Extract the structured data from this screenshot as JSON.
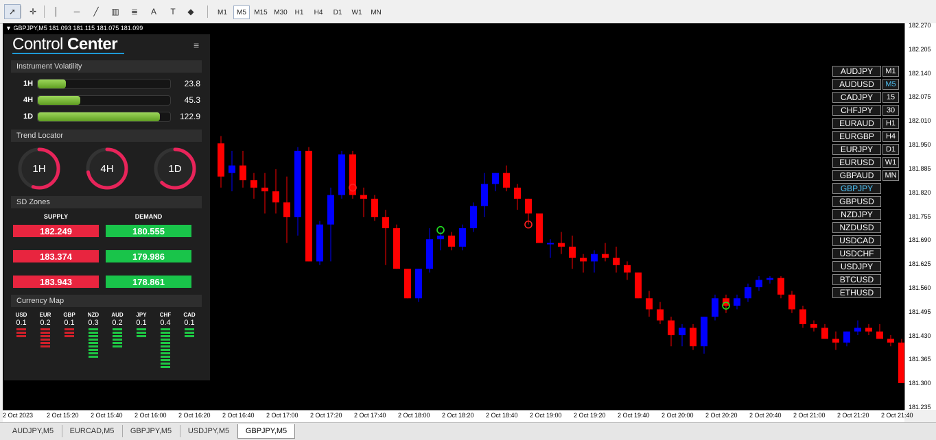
{
  "toolbar": {
    "tools": [
      {
        "name": "cursor-icon",
        "glyph": "➚"
      },
      {
        "name": "crosshair-icon",
        "glyph": "✛"
      },
      {
        "name": "vertical-line-icon",
        "glyph": "│"
      },
      {
        "name": "horizontal-line-icon",
        "glyph": "─"
      },
      {
        "name": "trend-line-icon",
        "glyph": "╱"
      },
      {
        "name": "channel-icon",
        "glyph": "▥"
      },
      {
        "name": "fibonacci-icon",
        "glyph": "≣"
      },
      {
        "name": "text-icon",
        "glyph": "A"
      },
      {
        "name": "text-label-icon",
        "glyph": "T"
      },
      {
        "name": "shapes-icon",
        "glyph": "◆"
      }
    ],
    "timeframes": [
      "M1",
      "M5",
      "M15",
      "M30",
      "H1",
      "H4",
      "D1",
      "W1",
      "MN"
    ],
    "active_timeframe": "M5"
  },
  "chart": {
    "header": "GBPJPY,M5  181.093 181.115 181.075 181.099",
    "ymin": 181.235,
    "ymax": 182.27,
    "y_labels": [
      "182.270",
      "182.205",
      "182.140",
      "182.075",
      "182.010",
      "181.950",
      "181.885",
      "181.820",
      "181.755",
      "181.690",
      "181.625",
      "181.560",
      "181.495",
      "181.430",
      "181.365",
      "181.300",
      "181.235"
    ],
    "x_labels": [
      "2 Oct 2023",
      "2 Oct 15:20",
      "2 Oct 15:40",
      "2 Oct 16:00",
      "2 Oct 16:20",
      "2 Oct 16:40",
      "2 Oct 17:00",
      "2 Oct 17:20",
      "2 Oct 17:40",
      "2 Oct 18:00",
      "2 Oct 18:20",
      "2 Oct 18:40",
      "2 Oct 19:00",
      "2 Oct 19:20",
      "2 Oct 19:40",
      "2 Oct 20:00",
      "2 Oct 20:20",
      "2 Oct 20:40",
      "2 Oct 21:00",
      "2 Oct 21:20",
      "2 Oct 21:40"
    ],
    "colors": {
      "bull": "#0000ff",
      "bear": "#ff0000",
      "signal_sell": "#ff2020",
      "signal_buy": "#20e020"
    }
  },
  "chart_data": {
    "type": "candlestick",
    "ohlc": [
      [
        181.95,
        181.97,
        181.83,
        181.86
      ],
      [
        181.87,
        181.93,
        181.82,
        181.89
      ],
      [
        181.89,
        181.93,
        181.83,
        181.85
      ],
      [
        181.85,
        181.87,
        181.8,
        181.83
      ],
      [
        181.83,
        181.87,
        181.76,
        181.82
      ],
      [
        181.82,
        181.88,
        181.76,
        181.79
      ],
      [
        181.79,
        181.86,
        181.68,
        181.75
      ],
      [
        181.75,
        181.94,
        181.7,
        181.93
      ],
      [
        181.93,
        181.94,
        181.63,
        181.63
      ],
      [
        181.63,
        181.74,
        181.62,
        181.73
      ],
      [
        181.73,
        181.83,
        181.63,
        181.81
      ],
      [
        181.81,
        181.93,
        181.8,
        181.92
      ],
      [
        181.92,
        181.93,
        181.8,
        181.81
      ],
      [
        181.81,
        181.83,
        181.75,
        181.8
      ],
      [
        181.8,
        181.81,
        181.74,
        181.75
      ],
      [
        181.75,
        181.77,
        181.62,
        181.72
      ],
      [
        181.72,
        181.73,
        181.61,
        181.61
      ],
      [
        181.61,
        181.61,
        181.53,
        181.53
      ],
      [
        181.53,
        181.61,
        181.52,
        181.61
      ],
      [
        181.61,
        181.72,
        181.6,
        181.69
      ],
      [
        181.69,
        181.71,
        181.66,
        181.7
      ],
      [
        181.7,
        181.71,
        181.66,
        181.67
      ],
      [
        181.67,
        181.73,
        181.66,
        181.72
      ],
      [
        181.72,
        181.79,
        181.71,
        181.78
      ],
      [
        181.78,
        181.87,
        181.75,
        181.84
      ],
      [
        181.84,
        181.87,
        181.82,
        181.87
      ],
      [
        181.87,
        181.89,
        181.82,
        181.83
      ],
      [
        181.83,
        181.84,
        181.77,
        181.8
      ],
      [
        181.8,
        181.8,
        181.73,
        181.76
      ],
      [
        181.76,
        181.76,
        181.68,
        181.68
      ],
      [
        181.68,
        181.69,
        181.64,
        181.68
      ],
      [
        181.68,
        181.71,
        181.65,
        181.67
      ],
      [
        181.67,
        181.7,
        181.61,
        181.64
      ],
      [
        181.64,
        181.65,
        181.6,
        181.63
      ],
      [
        181.63,
        181.66,
        181.6,
        181.65
      ],
      [
        181.65,
        181.68,
        181.63,
        181.64
      ],
      [
        181.64,
        181.67,
        181.6,
        181.62
      ],
      [
        181.62,
        181.63,
        181.58,
        181.6
      ],
      [
        181.6,
        181.6,
        181.53,
        181.53
      ],
      [
        181.53,
        181.55,
        181.48,
        181.5
      ],
      [
        181.5,
        181.52,
        181.46,
        181.47
      ],
      [
        181.47,
        181.48,
        181.4,
        181.43
      ],
      [
        181.43,
        181.46,
        181.4,
        181.45
      ],
      [
        181.45,
        181.46,
        181.39,
        181.4
      ],
      [
        181.4,
        181.48,
        181.38,
        181.48
      ],
      [
        181.48,
        181.54,
        181.47,
        181.53
      ],
      [
        181.53,
        181.54,
        181.49,
        181.51
      ],
      [
        181.51,
        181.54,
        181.5,
        181.53
      ],
      [
        181.53,
        181.57,
        181.52,
        181.56
      ],
      [
        181.56,
        181.59,
        181.55,
        181.58
      ],
      [
        181.58,
        181.59,
        181.57,
        181.585
      ],
      [
        181.585,
        181.59,
        181.53,
        181.54
      ],
      [
        181.54,
        181.55,
        181.49,
        181.5
      ],
      [
        181.5,
        181.51,
        181.45,
        181.46
      ],
      [
        181.46,
        181.47,
        181.44,
        181.45
      ],
      [
        181.45,
        181.46,
        181.42,
        181.42
      ],
      [
        181.42,
        181.44,
        181.39,
        181.41
      ],
      [
        181.41,
        181.44,
        181.4,
        181.44
      ],
      [
        181.44,
        181.47,
        181.43,
        181.45
      ],
      [
        181.45,
        181.46,
        181.43,
        181.44
      ],
      [
        181.44,
        181.46,
        181.42,
        181.42
      ],
      [
        181.42,
        181.43,
        181.4,
        181.41
      ],
      [
        181.41,
        181.42,
        181.3,
        181.3
      ],
      [
        181.3,
        181.33,
        181.29,
        181.32
      ],
      [
        181.32,
        181.32,
        181.28,
        181.28
      ],
      [
        181.28,
        181.29,
        181.27,
        181.27
      ],
      [
        181.27,
        181.32,
        181.27,
        181.31
      ],
      [
        181.31,
        181.33,
        181.29,
        181.29
      ]
    ],
    "signals": [
      {
        "index": 12,
        "price": 181.83,
        "side": "sell"
      },
      {
        "index": 20,
        "price": 181.715,
        "side": "buy"
      },
      {
        "index": 28,
        "price": 181.73,
        "side": "sell"
      },
      {
        "index": 46,
        "price": 181.51,
        "side": "buy"
      }
    ]
  },
  "panel": {
    "title_light": "Control",
    "title_bold": "Center",
    "volatility": {
      "title": "Instrument Volatility",
      "rows": [
        {
          "label": "1H",
          "value": "23.8",
          "level": 0.21
        },
        {
          "label": "4H",
          "value": "45.3",
          "level": 0.32
        },
        {
          "label": "1D",
          "value": "122.9",
          "level": 0.92
        }
      ]
    },
    "trend": {
      "title": "Trend Locator",
      "items": [
        {
          "label": "1H",
          "level": 0.55
        },
        {
          "label": "4H",
          "level": 0.72
        },
        {
          "label": "1D",
          "level": 0.62
        }
      ],
      "color": "#e8245a"
    },
    "sd": {
      "title": "SD Zones",
      "supply_label": "SUPPLY",
      "demand_label": "DEMAND",
      "supply": [
        "182.249",
        "183.374",
        "183.943"
      ],
      "demand": [
        "180.555",
        "179.986",
        "178.861"
      ]
    },
    "currency_map": {
      "title": "Currency Map",
      "items": [
        {
          "cur": "USD",
          "val": "0.1",
          "bars": 3,
          "color": "#d0202a"
        },
        {
          "cur": "EUR",
          "val": "0.2",
          "bars": 6,
          "color": "#d0202a"
        },
        {
          "cur": "GBP",
          "val": "0.1",
          "bars": 3,
          "color": "#d0202a"
        },
        {
          "cur": "NZD",
          "val": "0.3",
          "bars": 9,
          "color": "#1ec844"
        },
        {
          "cur": "AUD",
          "val": "0.2",
          "bars": 6,
          "color": "#1ec844"
        },
        {
          "cur": "JPY",
          "val": "0.1",
          "bars": 3,
          "color": "#1ec844"
        },
        {
          "cur": "CHF",
          "val": "0.4",
          "bars": 12,
          "color": "#1ec844"
        },
        {
          "cur": "CAD",
          "val": "0.1",
          "bars": 3,
          "color": "#1ec844"
        }
      ]
    }
  },
  "symbols": {
    "items": [
      "AUDJPY",
      "AUDUSD",
      "CADJPY",
      "CHFJPY",
      "EURAUD",
      "EURGBP",
      "EURJPY",
      "EURUSD",
      "GBPAUD",
      "GBPJPY",
      "GBPUSD",
      "NZDJPY",
      "NZDUSD",
      "USDCAD",
      "USDCHF",
      "USDJPY",
      "BTCUSD",
      "ETHUSD"
    ],
    "active": "GBPJPY",
    "timeframes": [
      "M1",
      "M5",
      "15",
      "30",
      "H1",
      "H4",
      "D1",
      "W1",
      "MN"
    ],
    "active_timeframe": "M5",
    "active_color": "#4fc3f7"
  },
  "tabs": {
    "items": [
      "AUDJPY,M5",
      "EURCAD,M5",
      "GBPJPY,M5",
      "USDJPY,M5",
      "GBPJPY,M5"
    ],
    "active_index": 4
  }
}
